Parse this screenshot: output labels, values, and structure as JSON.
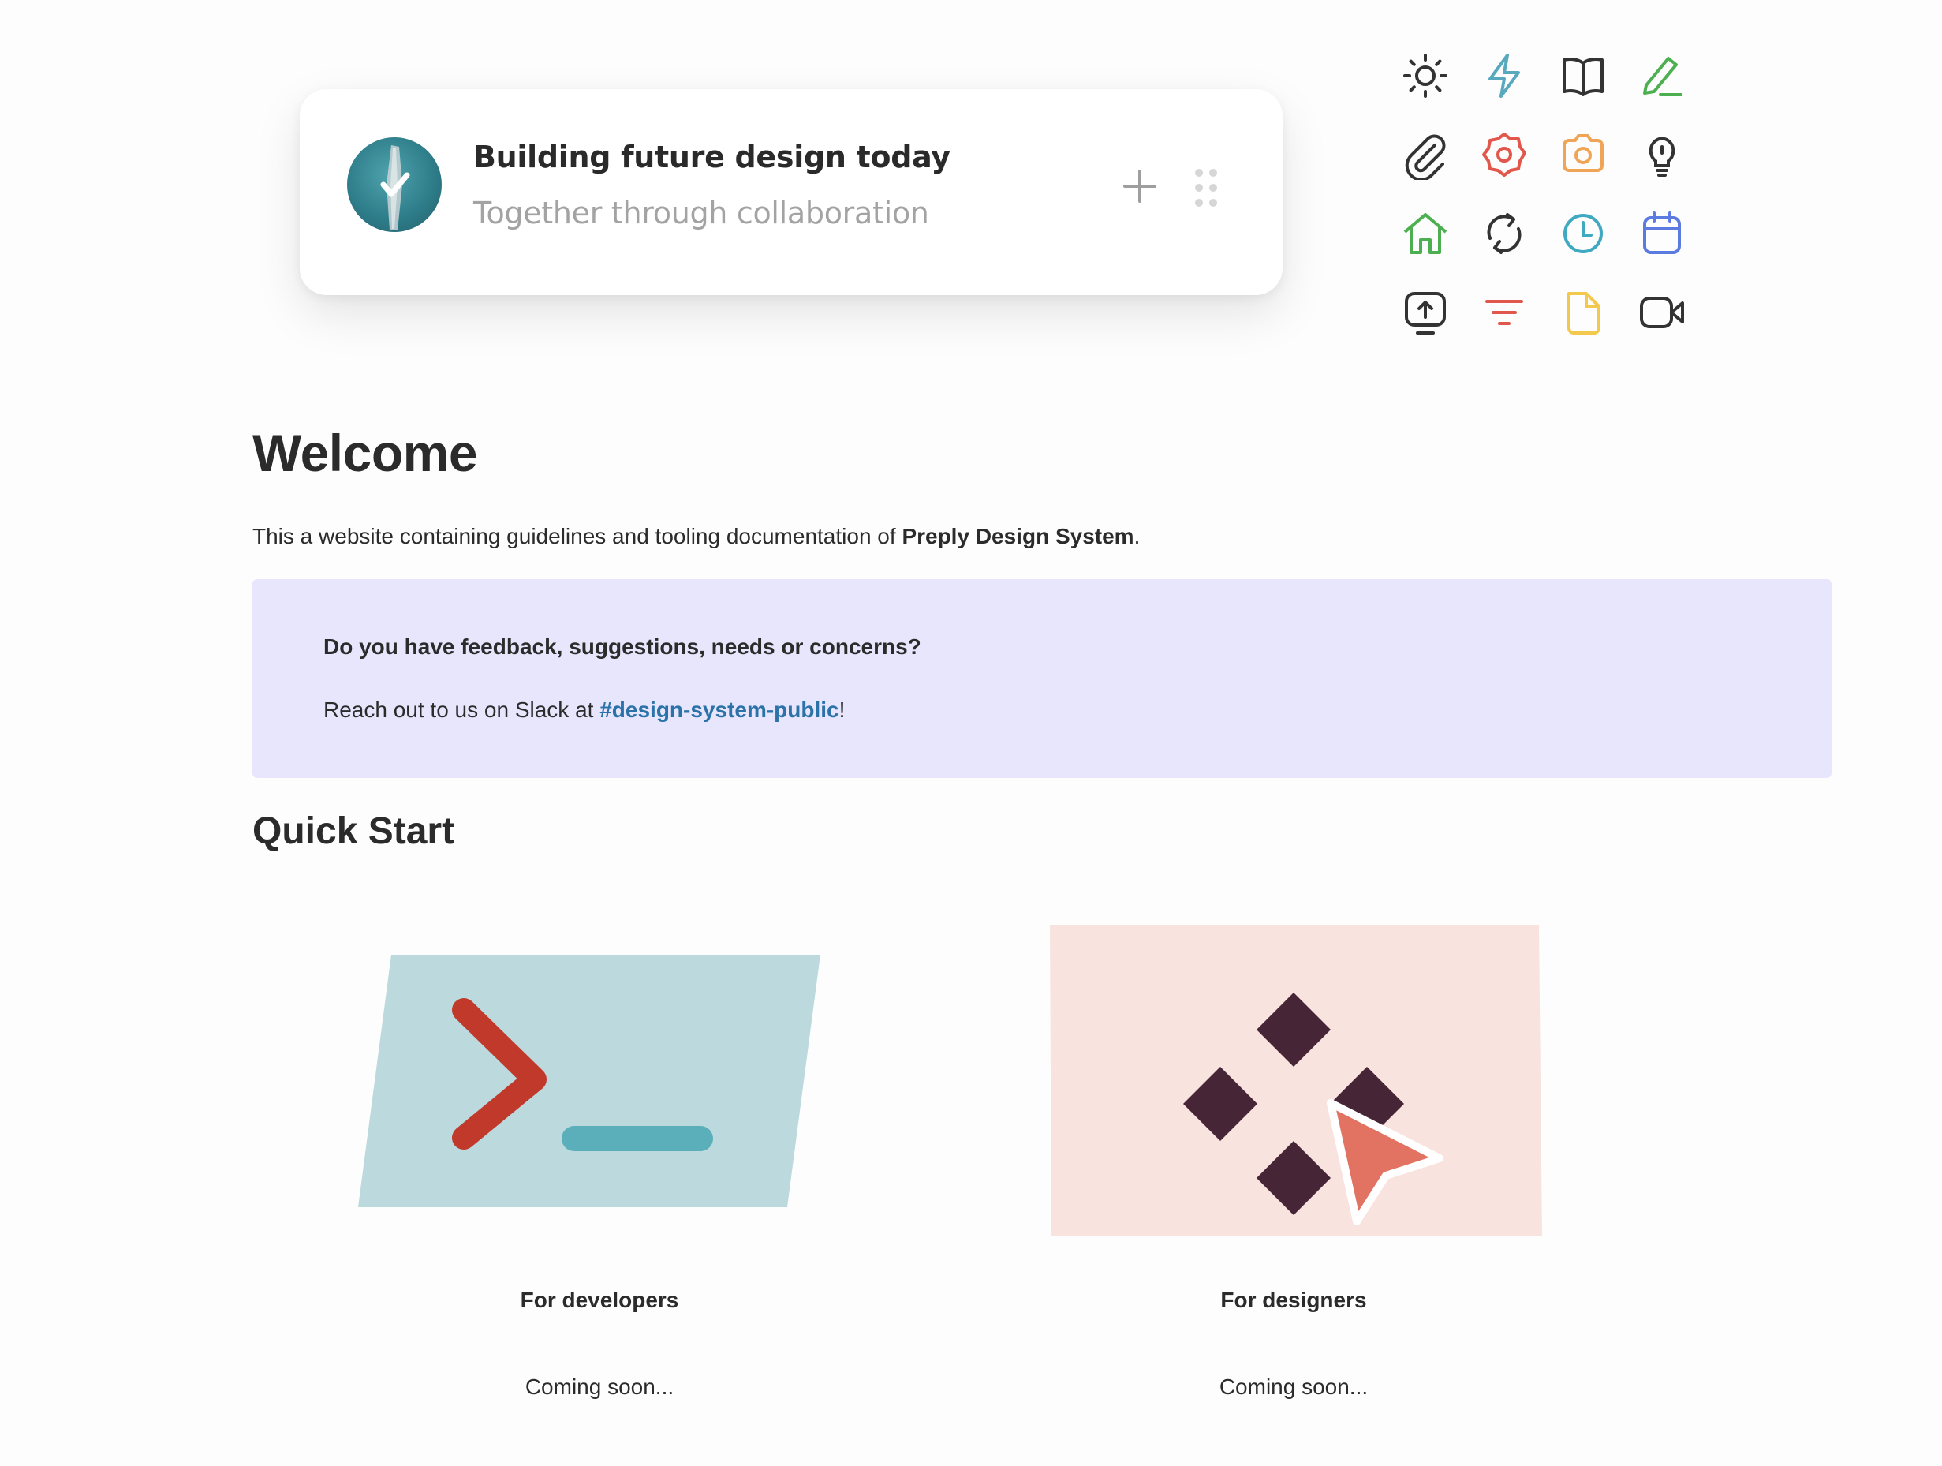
{
  "hero_card": {
    "title": "Building future design today",
    "subtitle": "Together through collaboration"
  },
  "icons": [
    {
      "name": "sun-icon",
      "color": "#333333"
    },
    {
      "name": "lightning-icon",
      "color": "#58a9be"
    },
    {
      "name": "book-icon",
      "color": "#333333"
    },
    {
      "name": "pencil-icon",
      "color": "#4caf50"
    },
    {
      "name": "paperclip-icon",
      "color": "#333333"
    },
    {
      "name": "gear-icon",
      "color": "#e2574c"
    },
    {
      "name": "camera-icon",
      "color": "#f0a455"
    },
    {
      "name": "lightbulb-icon",
      "color": "#333333"
    },
    {
      "name": "home-icon",
      "color": "#4caf50"
    },
    {
      "name": "refresh-icon",
      "color": "#333333"
    },
    {
      "name": "clock-icon",
      "color": "#3fa9c2"
    },
    {
      "name": "calendar-icon",
      "color": "#5b7be0"
    },
    {
      "name": "upload-screen-icon",
      "color": "#333333"
    },
    {
      "name": "filter-icon",
      "color": "#e2574c"
    },
    {
      "name": "document-icon",
      "color": "#f2c94c"
    },
    {
      "name": "video-icon",
      "color": "#333333"
    }
  ],
  "welcome": {
    "title": "Welcome",
    "intro_prefix": "This a website containing guidelines and tooling documentation of ",
    "intro_bold": "Preply Design System",
    "intro_suffix": "."
  },
  "callout": {
    "question": "Do you have feedback, suggestions, needs or concerns?",
    "line_prefix": "Reach out to us on Slack at ",
    "link": "#design-system-public",
    "line_suffix": "!"
  },
  "quick_start": {
    "title": "Quick Start",
    "cards": [
      {
        "label": "For developers",
        "status": "Coming soon..."
      },
      {
        "label": "For designers",
        "status": "Coming soon..."
      }
    ]
  },
  "colors": {
    "callout_bg": "#e8e6fd",
    "link": "#2a72a8",
    "dev_card_bg": "#bcdade",
    "designer_card_bg": "#f8e3de"
  }
}
